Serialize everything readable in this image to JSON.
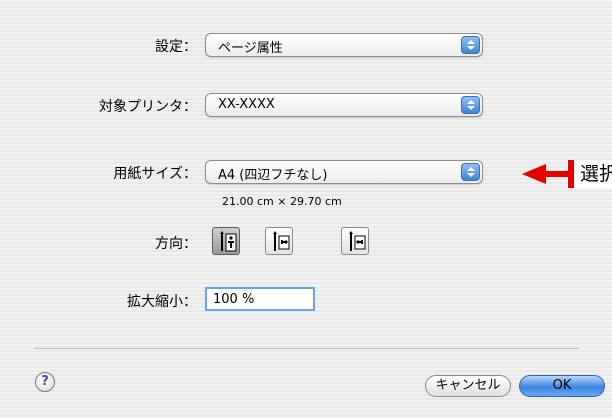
{
  "settings": {
    "label": "設定：",
    "value": "ページ属性"
  },
  "format_for": {
    "label": "対象プリンタ：",
    "value": "XX-XXXX"
  },
  "paper_size": {
    "label": "用紙サイズ：",
    "value": "A4 (四辺フチなし)",
    "dimensions": "21.00 cm × 29.70 cm"
  },
  "orientation": {
    "label": "方向：",
    "options": [
      {
        "icon": "portrait-orientation-icon",
        "selected": true
      },
      {
        "icon": "landscape-left-orientation-icon",
        "selected": false
      },
      {
        "icon": "landscape-right-orientation-icon",
        "selected": false
      }
    ]
  },
  "scale": {
    "label": "拡大縮小：",
    "value": "100 %"
  },
  "footer": {
    "help_label": "?",
    "cancel_label": "キャンセル",
    "ok_label": "OK"
  },
  "annotation": {
    "text": "選択",
    "color": "#e60000"
  }
}
